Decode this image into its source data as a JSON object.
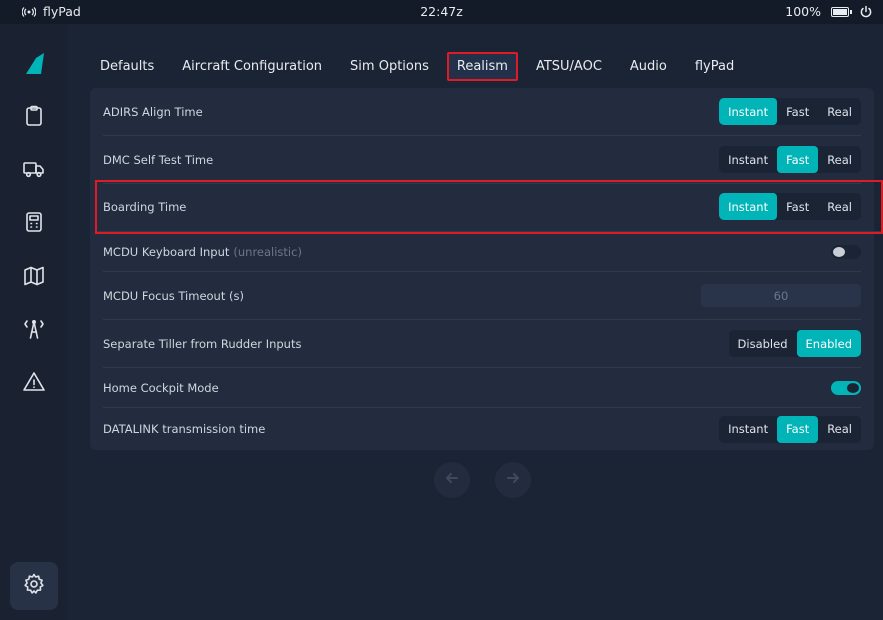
{
  "statusbar": {
    "app_name": "flyPad",
    "time": "22:47z",
    "battery": "100%"
  },
  "tabs": [
    {
      "label": "Defaults"
    },
    {
      "label": "Aircraft Configuration"
    },
    {
      "label": "Sim Options"
    },
    {
      "label": "Realism"
    },
    {
      "label": "ATSU/AOC"
    },
    {
      "label": "Audio"
    },
    {
      "label": "flyPad"
    }
  ],
  "active_tab": "Realism",
  "settings": {
    "adirs": {
      "label": "ADIRS Align Time",
      "options": [
        "Instant",
        "Fast",
        "Real"
      ],
      "selected": "Instant"
    },
    "dmc": {
      "label": "DMC Self Test Time",
      "options": [
        "Instant",
        "Fast",
        "Real"
      ],
      "selected": "Fast"
    },
    "boarding": {
      "label": "Boarding Time",
      "options": [
        "Instant",
        "Fast",
        "Real"
      ],
      "selected": "Instant"
    },
    "mcdu_kb": {
      "label": "MCDU Keyboard Input",
      "note": "(unrealistic)",
      "enabled": false
    },
    "mcdu_focus": {
      "label": "MCDU Focus Timeout (s)",
      "value": "60"
    },
    "tiller": {
      "label": "Separate Tiller from Rudder Inputs",
      "options": [
        "Disabled",
        "Enabled"
      ],
      "selected": "Enabled"
    },
    "home_cockpit": {
      "label": "Home Cockpit Mode",
      "enabled": true
    },
    "datalink": {
      "label": "DATALINK transmission time",
      "options": [
        "Instant",
        "Fast",
        "Real"
      ],
      "selected": "Fast"
    }
  },
  "colors": {
    "accent": "#00b4b8",
    "highlight": "#e01b24",
    "background": "#1b2434"
  }
}
